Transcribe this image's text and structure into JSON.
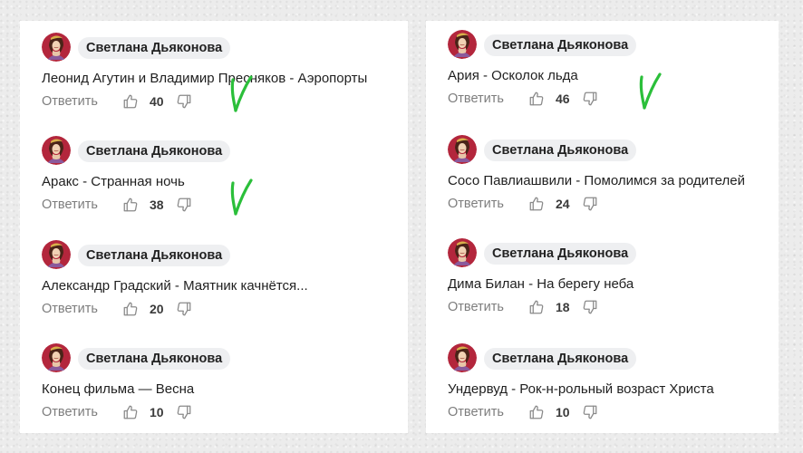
{
  "left_column": [
    {
      "author": "Светлана Дьяконова",
      "text": "Леонид Агутин и Владимир Пресняков - Аэропорты",
      "reply_label": "Ответить",
      "likes": "40",
      "has_check_mark": true
    },
    {
      "author": "Светлана Дьяконова",
      "text": "Аракс - Странная ночь",
      "reply_label": "Ответить",
      "likes": "38",
      "has_check_mark": true
    },
    {
      "author": "Светлана Дьяконова",
      "text": "Александр Градский - Маятник качнётся...",
      "reply_label": "Ответить",
      "likes": "20",
      "has_check_mark": false
    },
    {
      "author": "Светлана Дьяконова",
      "text": "Конец фильма — Весна",
      "reply_label": "Ответить",
      "likes": "10",
      "has_check_mark": false
    }
  ],
  "right_column": [
    {
      "author": "Светлана Дьяконова",
      "text": "Ария - Осколок льда",
      "reply_label": "Ответить",
      "likes": "46",
      "has_check_mark": true
    },
    {
      "author": "Светлана Дьяконова",
      "text": "Сосо Павлиашвили - Помолимся за родителей",
      "reply_label": "Ответить",
      "likes": "24",
      "has_check_mark": false
    },
    {
      "author": "Светлана Дьяконова",
      "text": "Дима Билан - На берегу неба",
      "reply_label": "Ответить",
      "likes": "18",
      "has_check_mark": false
    },
    {
      "author": "Светлана Дьяконова",
      "text": "Ундервуд - Рок-н-рольный возраст Христа",
      "reply_label": "Ответить",
      "likes": "10",
      "has_check_mark": false
    }
  ],
  "colors": {
    "check_mark": "#2bbf3a",
    "author_pill": "#eeeff1",
    "reply_text": "#7d7d7d",
    "page_background": "#ececec"
  },
  "icons": {
    "like": "thumbs-up-icon",
    "dislike": "thumbs-down-icon",
    "check": "green-check-mark-icon"
  }
}
